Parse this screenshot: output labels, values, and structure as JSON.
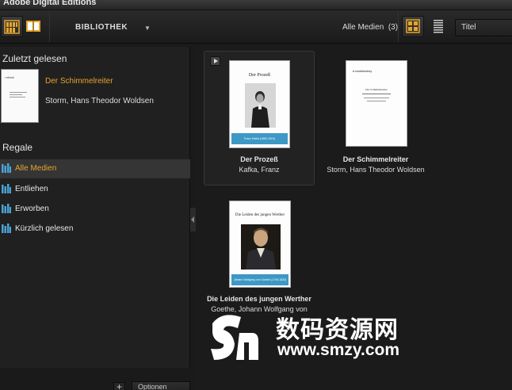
{
  "window": {
    "title": "Adobe Digital Editions"
  },
  "toolbar": {
    "library_label": "BIBLIOTHEK",
    "filter_label": "Alle Medien",
    "filter_count": "(3)",
    "sort_value": "Titel"
  },
  "sidebar": {
    "recent_header": "Zuletzt gelesen",
    "recent": {
      "title": "Der Schimmelreiter",
      "author": "Storm, Hans Theodor Woldsen"
    },
    "shelves_header": "Regale",
    "shelves": [
      {
        "label": "Alle Medien",
        "selected": true
      },
      {
        "label": "Entliehen",
        "selected": false
      },
      {
        "label": "Erworben",
        "selected": false
      },
      {
        "label": "Kürzlich gelesen",
        "selected": false
      }
    ],
    "add_label": "+",
    "options_label": "Optionen"
  },
  "books": [
    {
      "title": "Der Prozeß",
      "author": "Kafka, Franz",
      "cover_title": "Der Prozeß",
      "cover_band": "Franz Kafka (1883-1924)"
    },
    {
      "title": "Der Schimmelreiter",
      "author": "Storm, Hans Theodor Woldsen",
      "cover_logo": "e-bookfactory",
      "cover_title": "Der Schimmelreiter"
    },
    {
      "title": "Die Leiden des jungen Werther",
      "author": "Goethe, Johann Wolfgang von",
      "cover_title": "Die Leiden des jungen Werther",
      "cover_band": "Johann Wolfgang von Goethe (1749-1832)"
    }
  ],
  "watermark": {
    "cn_text": "数码资源网",
    "url": "www.smzy.com"
  },
  "colors": {
    "accent": "#e6a52c",
    "shelf_icon": "#4aa3d6",
    "cover_band": "#3d98c6"
  }
}
